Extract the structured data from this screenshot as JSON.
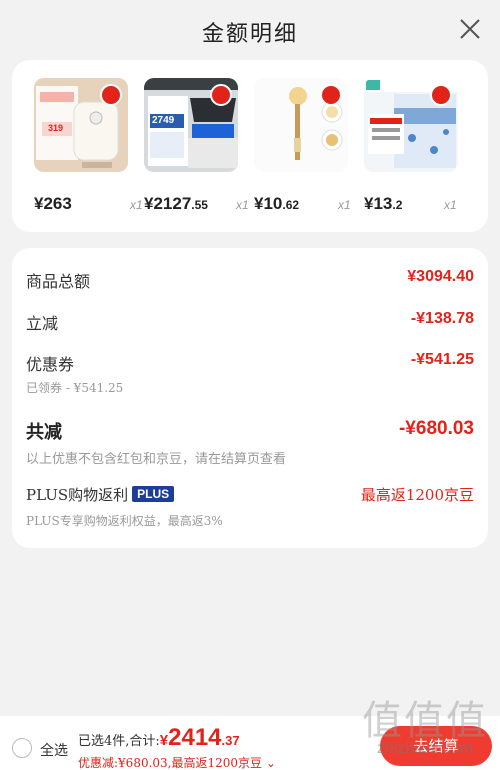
{
  "header": {
    "title": "金额明细"
  },
  "products": [
    {
      "price_int": "¥263",
      "price_dec": "",
      "qty": "x1",
      "thumb_text": "319"
    },
    {
      "price_int": "¥2127",
      "price_dec": ".55",
      "qty": "x1",
      "thumb_text": "2749"
    },
    {
      "price_int": "¥10",
      "price_dec": ".62",
      "qty": "x1",
      "thumb_text": ""
    },
    {
      "price_int": "¥13",
      "price_dec": ".2",
      "qty": "x1",
      "thumb_text": ""
    }
  ],
  "detail": {
    "goods_total_label": "商品总额",
    "goods_total_value": "¥3094.40",
    "instant_off_label": "立减",
    "instant_off_value": "-¥138.78",
    "coupon_label": "优惠券",
    "coupon_value": "-¥541.25",
    "coupon_sub": "已领券 - ¥541.25",
    "total_off_label": "共减",
    "total_off_value": "-¥680.03",
    "total_off_sub": "以上优惠不包含红包和京豆，请在结算页查看",
    "plus_label": "PLUS购物返利",
    "plus_badge": "PLUS",
    "plus_value": "最高返1200京豆",
    "plus_sub": "PLUS专享购物返利权益，最高返3%"
  },
  "bottom": {
    "select_all": "全选",
    "selected_text": "已选4件,合计:",
    "total_sym": "¥",
    "total_int": "2414",
    "total_dec": ".37",
    "discount_line": "优惠减:¥680.03,最高返1200京豆 ⌄",
    "checkout_label": "去结算"
  },
  "watermark": {
    "text": "值值值",
    "url": "zhizhizhi.com"
  },
  "colors": {
    "accent": "#e2231a",
    "plus": "#1c3e96"
  }
}
